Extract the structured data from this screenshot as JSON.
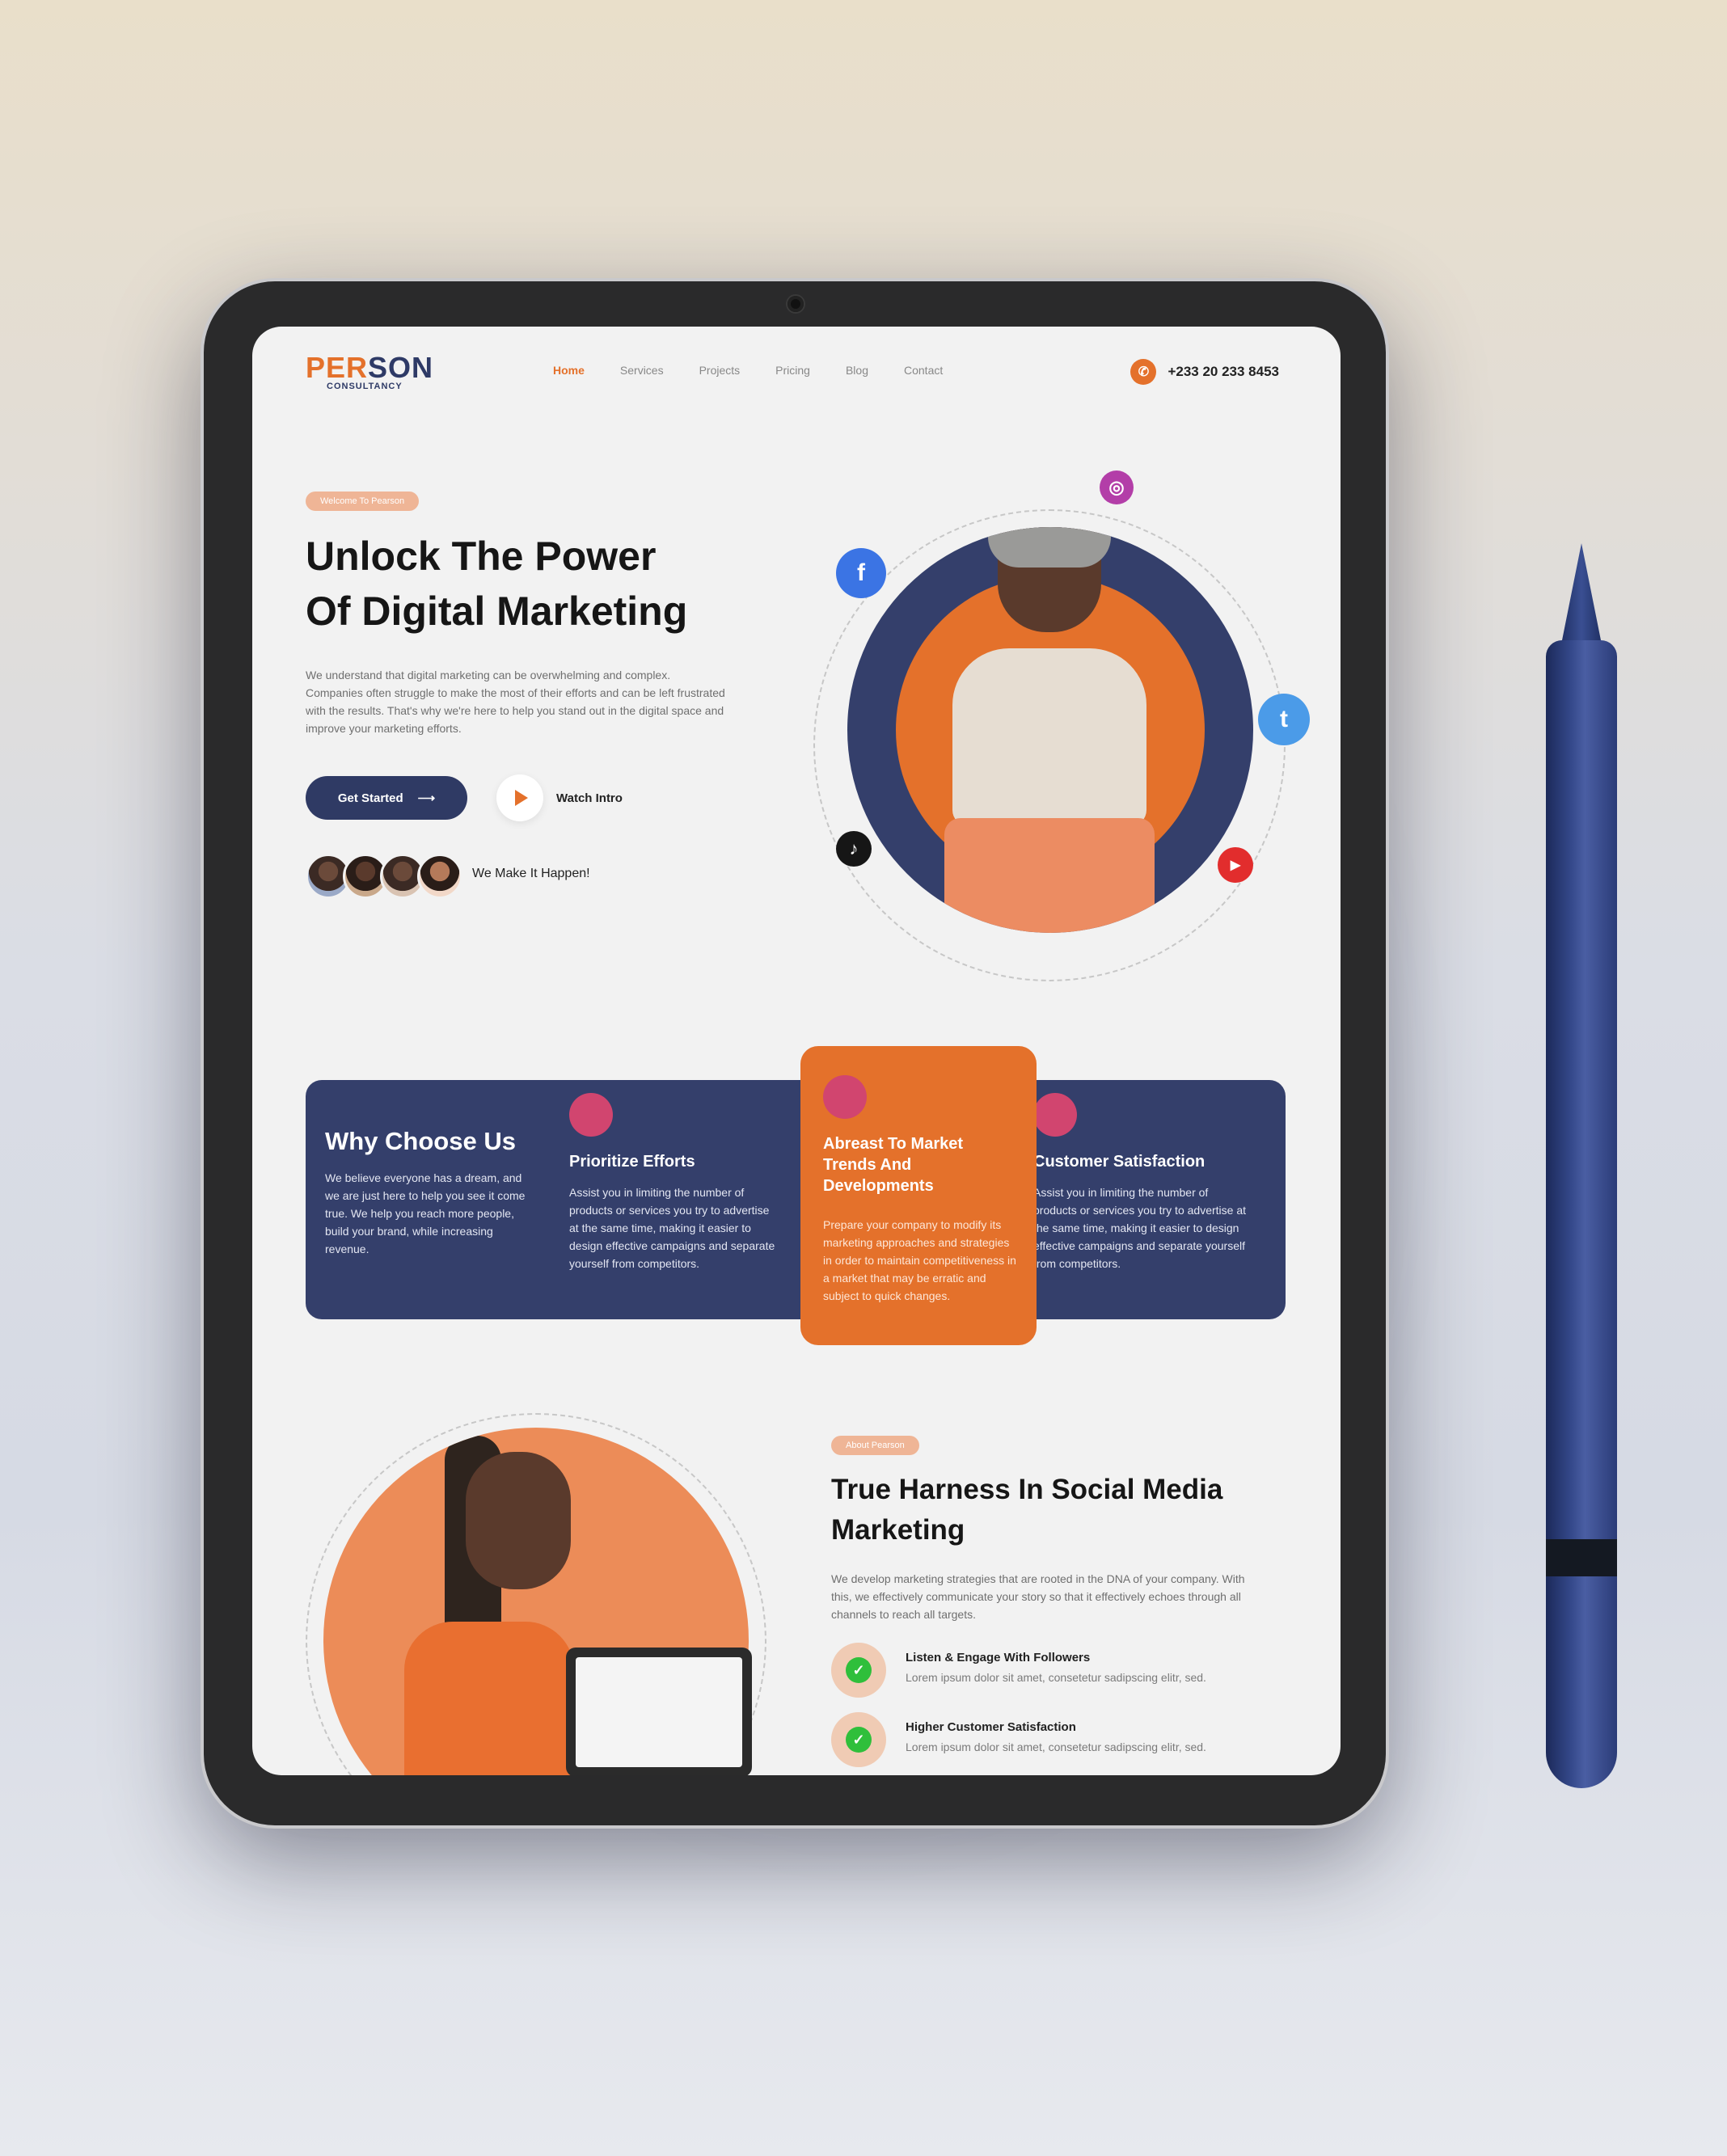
{
  "header": {
    "logo_main": "PE",
    "logo_r": "R",
    "logo_end": "SON",
    "logo_sub": "CONSULTANCY",
    "nav": [
      "Home",
      "Services",
      "Projects",
      "Pricing",
      "Blog",
      "Contact"
    ],
    "nav_active": "Home",
    "phone": "+233 20 233 8453"
  },
  "hero": {
    "pill": "Welcome To Pearson",
    "title_line1": "Unlock The Power",
    "title_line2": "Of Digital Marketing",
    "description": "We understand that digital marketing can be overwhelming and complex. Companies often struggle to make the most of their efforts and can be left frustrated with the results. That's why we're here to help you stand out in the digital space and improve your marketing efforts.",
    "cta": "Get Started",
    "watch": "Watch Intro",
    "tagline": "We Make It Happen!"
  },
  "features": {
    "intro_title": "Why Choose Us",
    "intro_text": "We believe everyone has a dream, and we are just here to help you see it come true. We help you reach more people, build your brand, while increasing revenue.",
    "items": [
      {
        "title": "Prioritize Efforts",
        "text": "Assist you in limiting the number of products or services you try to advertise at the same time, making it easier to design effective campaigns and separate yourself from competitors."
      },
      {
        "title": "Abreast To Market Trends And Developments",
        "text": "Prepare your company to modify its marketing approaches and strategies in order to maintain competitiveness in a market that may be erratic and subject to quick changes."
      },
      {
        "title": "Customer Satisfaction",
        "text": "Assist you in limiting the number of products or services you try to advertise at the same time, making it easier to design effective campaigns and separate yourself from competitors."
      }
    ]
  },
  "about": {
    "pill": "About Pearson",
    "title": "True Harness In Social Media Marketing",
    "description": "We develop marketing strategies that are rooted in the DNA of your company. With this, we effectively communicate your story so that it effectively echoes through all channels to reach all targets.",
    "checks": [
      {
        "title": "Listen & Engage With Followers",
        "text": "Lorem ipsum dolor sit amet, consetetur sadipscing elitr, sed."
      },
      {
        "title": "Higher Customer Satisfaction",
        "text": "Lorem ipsum dolor sit amet, consetetur sadipscing elitr, sed."
      }
    ]
  },
  "colors": {
    "navy": "#343f6b",
    "orange": "#e4712b",
    "pink": "#d1456f"
  },
  "icons": {
    "facebook": "f",
    "instagram": "◎",
    "twitter": "t",
    "tiktok": "♪",
    "youtube": "▶",
    "phone": "✆",
    "arrow": "⟶",
    "check": "✓"
  }
}
